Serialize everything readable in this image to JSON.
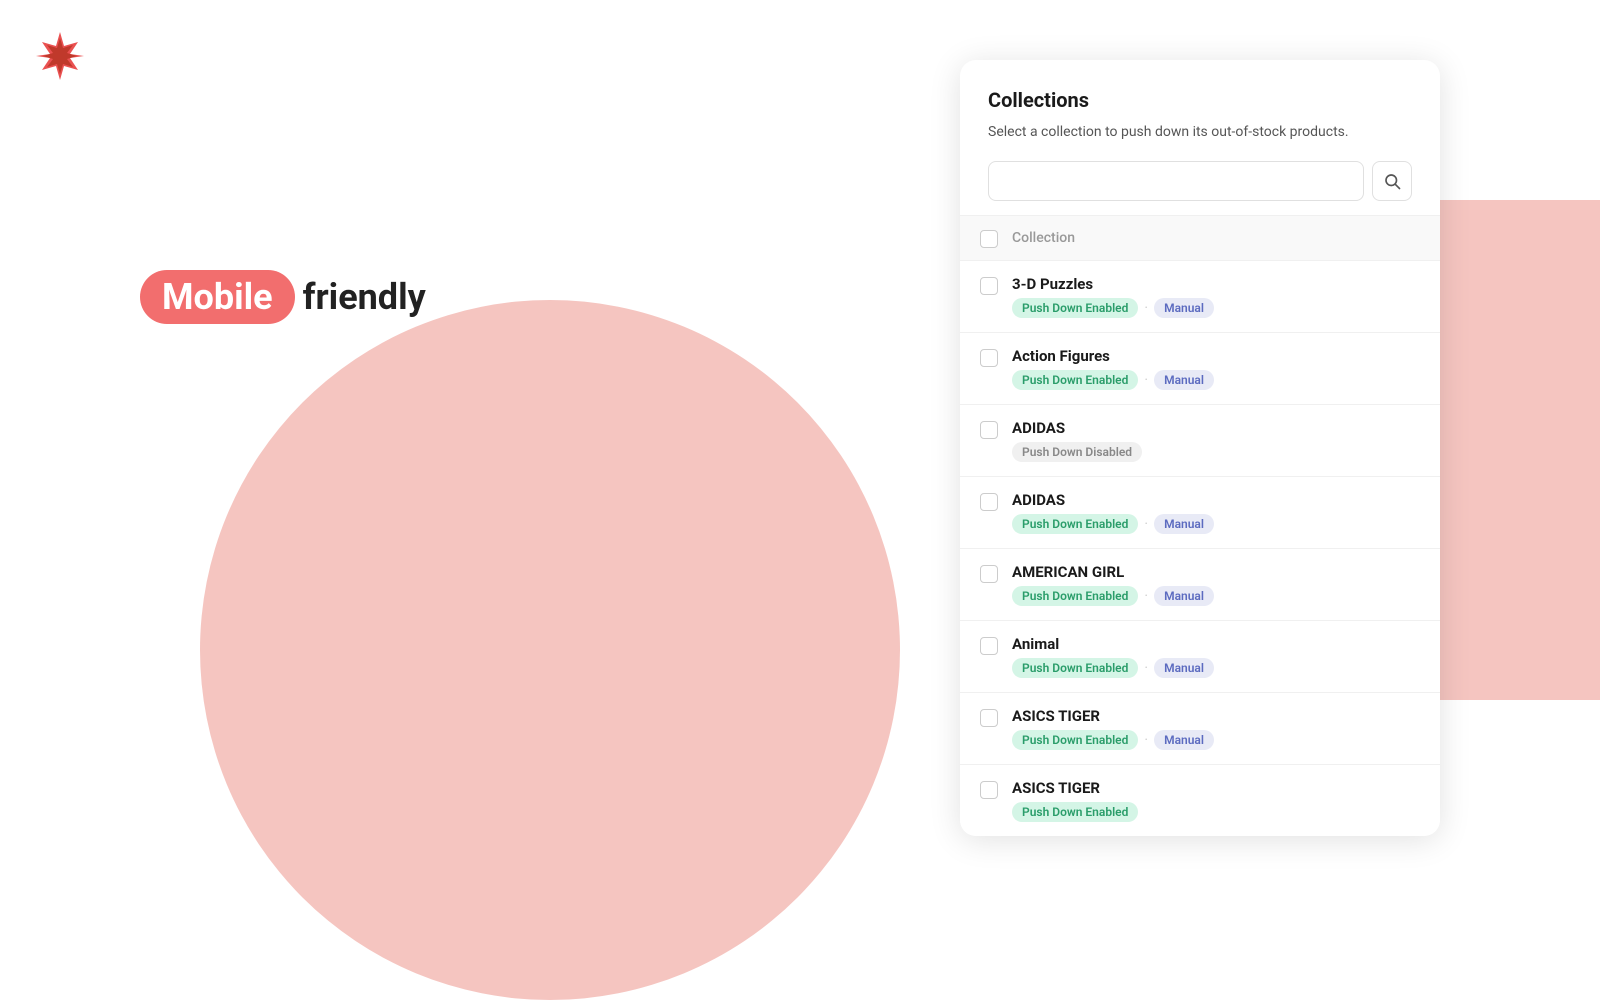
{
  "logo": {
    "alt": "App Logo"
  },
  "tagline": {
    "mobile": "Mobile",
    "friendly": "friendly"
  },
  "panel": {
    "title": "Collections",
    "description": "Select a collection to push down its out-of-stock products.",
    "search": {
      "placeholder": "",
      "button_label": "🔍"
    },
    "header": {
      "label": "Collection"
    },
    "items": [
      {
        "name": "3-D Puzzles",
        "badge1": "Push Down Enabled",
        "badge1_type": "green",
        "badge2": "Manual",
        "badge2_type": "blue"
      },
      {
        "name": "Action Figures",
        "badge1": "Push Down Enabled",
        "badge1_type": "green",
        "badge2": "Manual",
        "badge2_type": "blue"
      },
      {
        "name": "ADIDAS",
        "badge1": "Push Down Disabled",
        "badge1_type": "gray",
        "badge2": null,
        "badge2_type": null
      },
      {
        "name": "ADIDAS",
        "badge1": "Push Down Enabled",
        "badge1_type": "green",
        "badge2": "Manual",
        "badge2_type": "blue"
      },
      {
        "name": "AMERICAN GIRL",
        "badge1": "Push Down Enabled",
        "badge1_type": "green",
        "badge2": "Manual",
        "badge2_type": "blue"
      },
      {
        "name": "Animal",
        "badge1": "Push Down Enabled",
        "badge1_type": "green",
        "badge2": "Manual",
        "badge2_type": "blue"
      },
      {
        "name": "ASICS TIGER",
        "badge1": "Push Down Enabled",
        "badge1_type": "green",
        "badge2": "Manual",
        "badge2_type": "blue"
      },
      {
        "name": "ASICS TIGER",
        "badge1": "Push Down Enabled",
        "badge1_type": "green",
        "badge2": null,
        "badge2_type": null
      }
    ]
  }
}
